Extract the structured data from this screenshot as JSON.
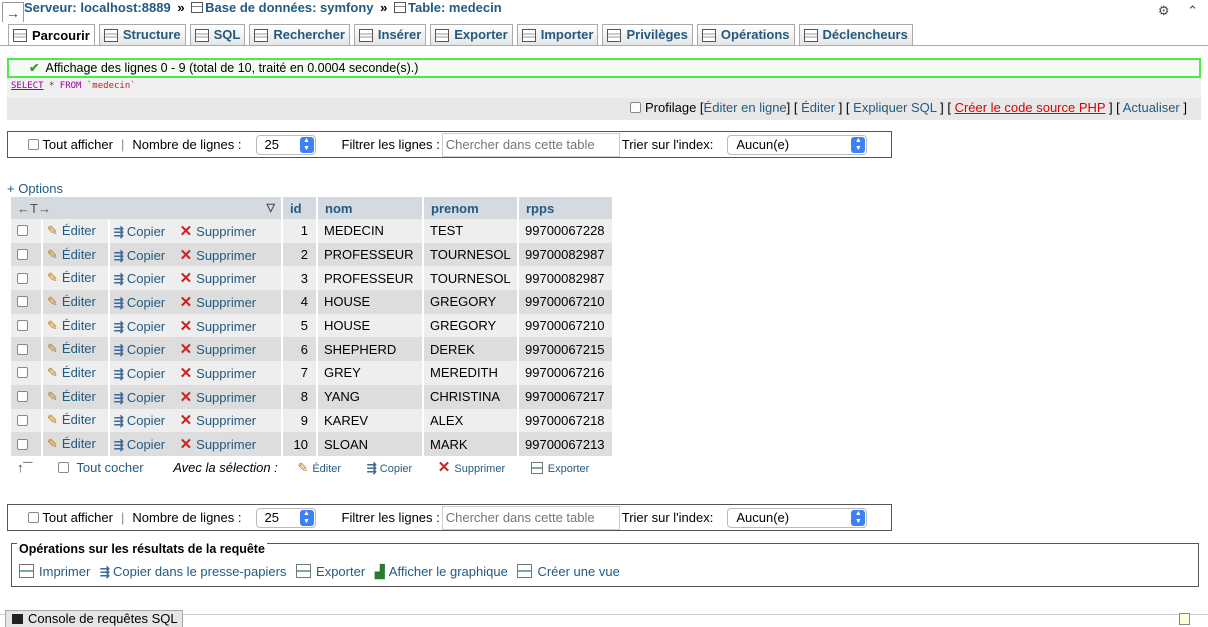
{
  "breadcrumb": {
    "server": "Serveur: localhost:8889",
    "database": "Base de données: symfony",
    "table": "Table: medecin",
    "sep": "»"
  },
  "tabs": [
    {
      "label": "Parcourir",
      "icon": "browse-icon",
      "active": true
    },
    {
      "label": "Structure",
      "icon": "structure-icon"
    },
    {
      "label": "SQL",
      "icon": "sql-icon"
    },
    {
      "label": "Rechercher",
      "icon": "search-icon"
    },
    {
      "label": "Insérer",
      "icon": "insert-icon"
    },
    {
      "label": "Exporter",
      "icon": "export-icon"
    },
    {
      "label": "Importer",
      "icon": "import-icon"
    },
    {
      "label": "Privilèges",
      "icon": "privileges-icon"
    },
    {
      "label": "Opérations",
      "icon": "operations-icon"
    },
    {
      "label": "Déclencheurs",
      "icon": "triggers-icon"
    }
  ],
  "message": "Affichage des lignes 0 - 9 (total de 10, traité en 0.0004 seconde(s).)",
  "sql": {
    "select": "SELECT",
    "star": "*",
    "from": "FROM",
    "table": "`medecin`"
  },
  "sql_actions": {
    "profiling": "Profilage",
    "edit_inline": "Éditer en ligne",
    "edit": "Éditer",
    "explain": "Expliquer SQL",
    "php_code": "Créer le code source PHP",
    "refresh": "Actualiser"
  },
  "nav": {
    "show_all": "Tout afficher",
    "rows_label": "Nombre de lignes :",
    "rows_value": "25",
    "filter_label": "Filtrer les lignes :",
    "filter_placeholder": "Chercher dans cette table",
    "index_label": "Trier sur l'index:",
    "index_value": "Aucun(e)"
  },
  "options_link": "+ Options",
  "columns": [
    "id",
    "nom",
    "prenom",
    "rpps"
  ],
  "row_actions": {
    "edit": "Éditer",
    "copy": "Copier",
    "delete": "Supprimer"
  },
  "rows": [
    {
      "id": "1",
      "nom": "MEDECIN",
      "prenom": "TEST",
      "rpps": "99700067228"
    },
    {
      "id": "2",
      "nom": "PROFESSEUR",
      "prenom": "TOURNESOL",
      "rpps": "99700082987"
    },
    {
      "id": "3",
      "nom": "PROFESSEUR",
      "prenom": "TOURNESOL",
      "rpps": "99700082987"
    },
    {
      "id": "4",
      "nom": "HOUSE",
      "prenom": "GREGORY",
      "rpps": "99700067210"
    },
    {
      "id": "5",
      "nom": "HOUSE",
      "prenom": "GREGORY",
      "rpps": "99700067210"
    },
    {
      "id": "6",
      "nom": "SHEPHERD",
      "prenom": "DEREK",
      "rpps": "99700067215"
    },
    {
      "id": "7",
      "nom": "GREY",
      "prenom": "MEREDITH",
      "rpps": "99700067216"
    },
    {
      "id": "8",
      "nom": "YANG",
      "prenom": "CHRISTINA",
      "rpps": "99700067217"
    },
    {
      "id": "9",
      "nom": "KAREV",
      "prenom": "ALEX",
      "rpps": "99700067218"
    },
    {
      "id": "10",
      "nom": "SLOAN",
      "prenom": "MARK",
      "rpps": "99700067213"
    }
  ],
  "with_selection": {
    "check_all": "Tout cocher",
    "label": "Avec la sélection :",
    "edit": "Éditer",
    "copy": "Copier",
    "delete": "Supprimer",
    "export": "Exporter"
  },
  "query_ops": {
    "legend": "Opérations sur les résultats de la requête",
    "print": "Imprimer",
    "copy_clipboard": "Copier dans le presse-papiers",
    "export": "Exporter",
    "chart": "Afficher le graphique",
    "create_view": "Créer une vue"
  },
  "console": "Console de requêtes SQL"
}
